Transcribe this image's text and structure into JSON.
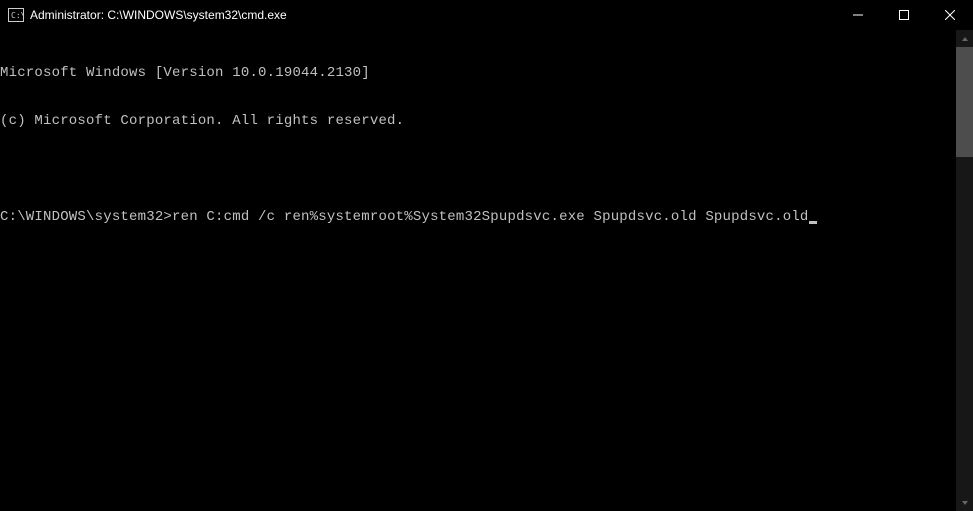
{
  "titlebar": {
    "title": "Administrator: C:\\WINDOWS\\system32\\cmd.exe"
  },
  "terminal": {
    "line1": "Microsoft Windows [Version 10.0.19044.2130]",
    "line2": "(c) Microsoft Corporation. All rights reserved.",
    "line3": "",
    "prompt": "C:\\WINDOWS\\system32>",
    "command": "ren C:cmd /c ren%systemroot%System32Spupdsvc.exe Spupdsvc.old Spupdsvc.old"
  }
}
